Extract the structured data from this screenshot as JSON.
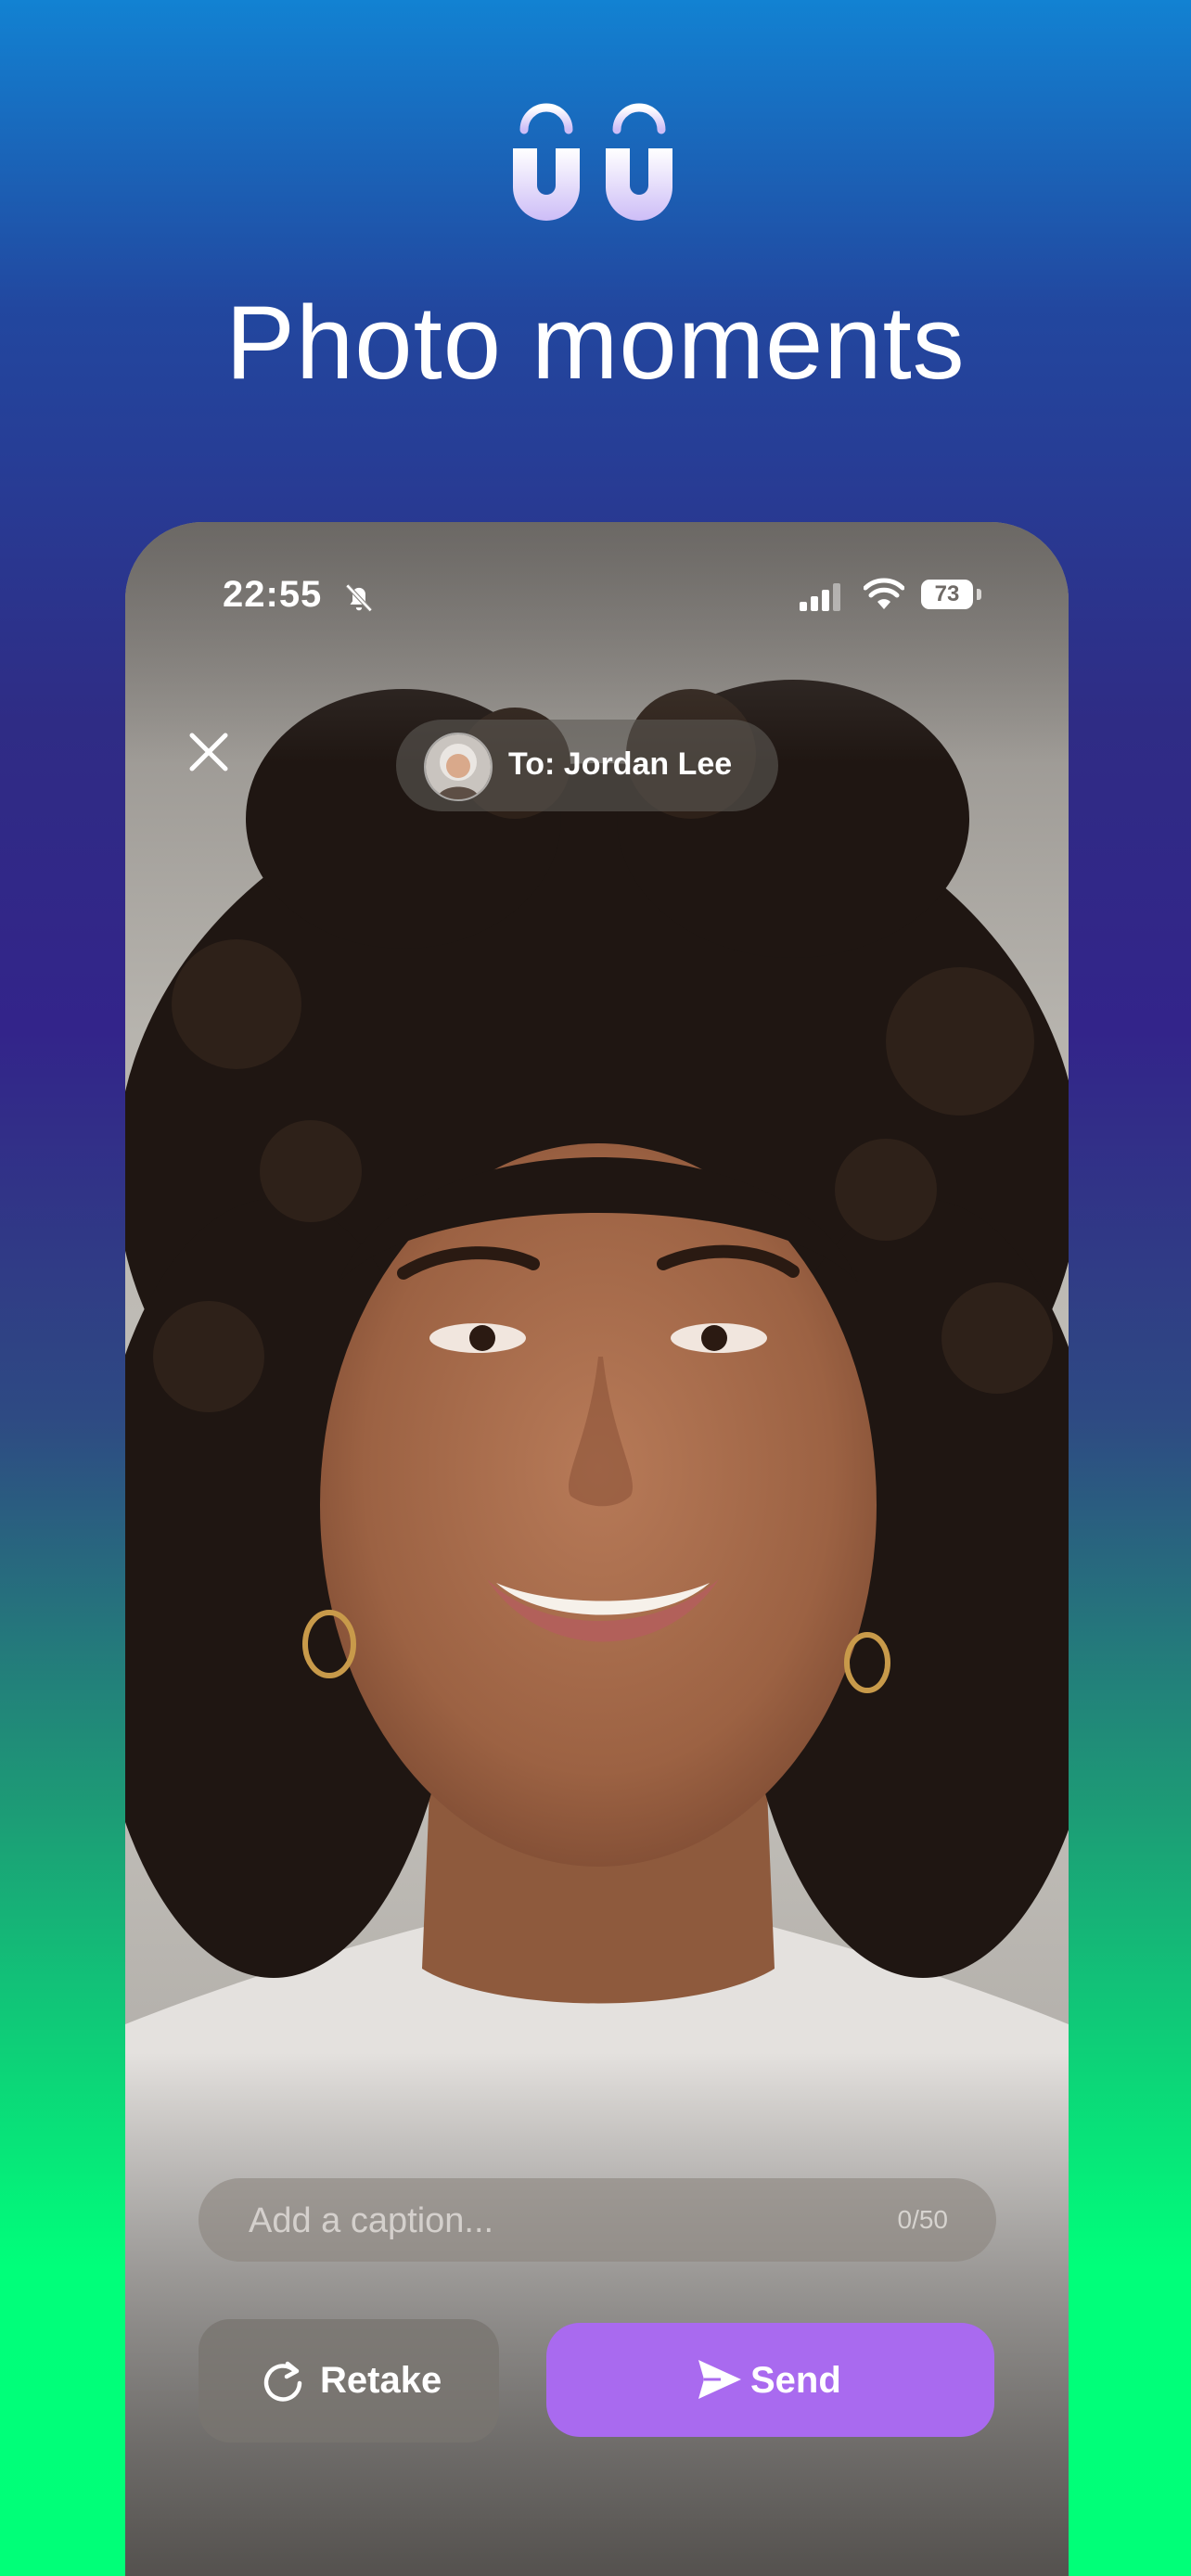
{
  "headline": "Photo moments",
  "status_bar": {
    "time": "22:55",
    "battery": "73"
  },
  "recipient": {
    "label": "To: Jordan Lee"
  },
  "caption": {
    "placeholder": "Add a caption...",
    "value": "",
    "counter": "0/50"
  },
  "actions": {
    "retake_label": "Retake",
    "send_label": "Send"
  },
  "colors": {
    "send_button": "#a96aef",
    "logo_tint": "#d9ccff"
  }
}
